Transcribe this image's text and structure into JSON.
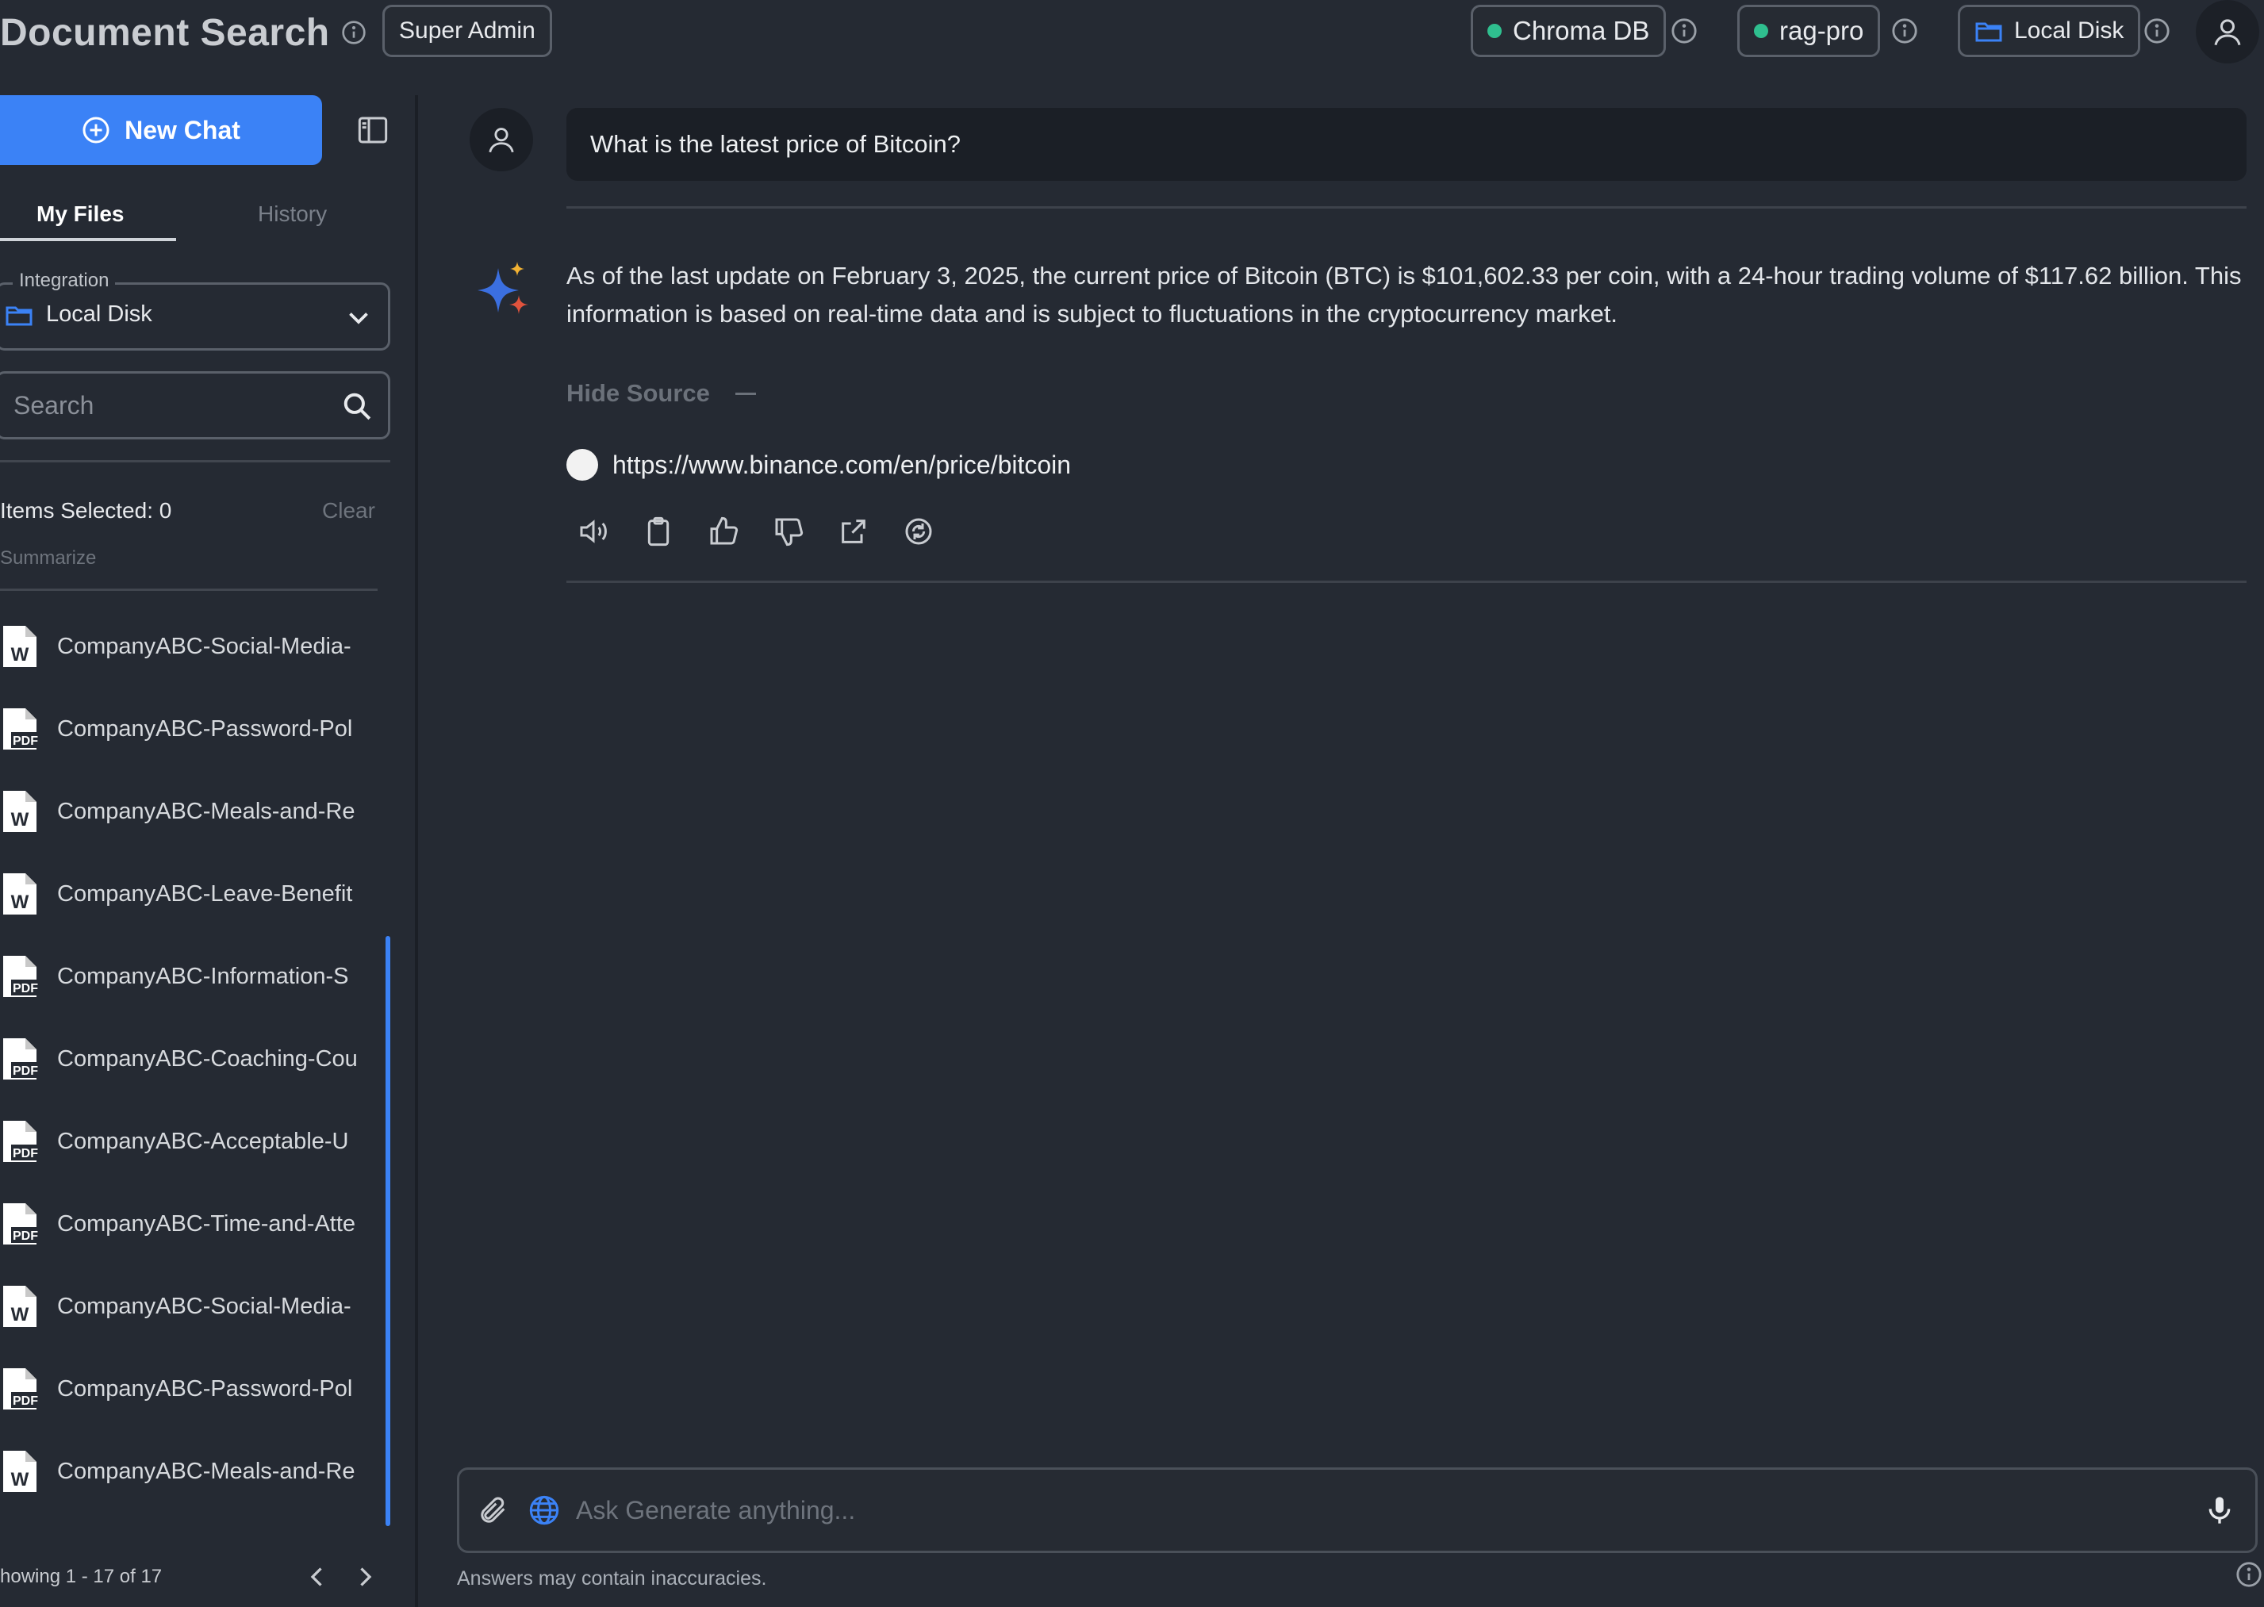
{
  "header": {
    "title": "Document Search",
    "role_badge": "Super Admin",
    "status_badges": [
      {
        "label": "Chroma DB",
        "status_color": "#2fbf8f"
      },
      {
        "label": "rag-pro",
        "status_color": "#2fbf8f"
      },
      {
        "label": "Local Disk",
        "icon": "folder-icon"
      }
    ],
    "accent_color": "#3b82f6"
  },
  "sidebar": {
    "new_chat_label": "New Chat",
    "tabs": [
      {
        "label": "My Files",
        "active": true
      },
      {
        "label": "History",
        "active": false
      }
    ],
    "integration": {
      "label": "Integration",
      "value": "Local Disk"
    },
    "search": {
      "placeholder": "Search"
    },
    "items_selected_label": "Items Selected: 0",
    "clear_label": "Clear",
    "summarize_label": "Summarize",
    "files": [
      {
        "name": "CompanyABC-Social-Media-",
        "type": "word"
      },
      {
        "name": "CompanyABC-Password-Pol",
        "type": "pdf"
      },
      {
        "name": "CompanyABC-Meals-and-Re",
        "type": "word"
      },
      {
        "name": "CompanyABC-Leave-Benefit",
        "type": "word"
      },
      {
        "name": "CompanyABC-Information-S",
        "type": "pdf"
      },
      {
        "name": "CompanyABC-Coaching-Cou",
        "type": "pdf"
      },
      {
        "name": "CompanyABC-Acceptable-U",
        "type": "pdf"
      },
      {
        "name": "CompanyABC-Time-and-Atte",
        "type": "pdf"
      },
      {
        "name": "CompanyABC-Social-Media-",
        "type": "word"
      },
      {
        "name": "CompanyABC-Password-Pol",
        "type": "pdf"
      },
      {
        "name": "CompanyABC-Meals-and-Re",
        "type": "word"
      }
    ],
    "pagination_text": "howing 1 - 17 of 17"
  },
  "chat": {
    "user_message": "What is the latest price of Bitcoin?",
    "answer": "As of the last update on February 3, 2025, the current price of Bitcoin (BTC) is $101,602.33 per coin, with a 24-hour trading volume of $117.62 billion. This information is based on real-time data and is subject to fluctuations in the cryptocurrency market.",
    "hide_source_label": "Hide Source",
    "sources": [
      "https://www.binance.com/en/price/bitcoin"
    ],
    "actions": [
      "speaker-icon",
      "clipboard-icon",
      "thumbs-up-icon",
      "thumbs-down-icon",
      "share-icon",
      "regenerate-icon"
    ]
  },
  "composer": {
    "placeholder": "Ask Generate anything...",
    "disclaimer": "Answers may contain inaccuracies."
  }
}
